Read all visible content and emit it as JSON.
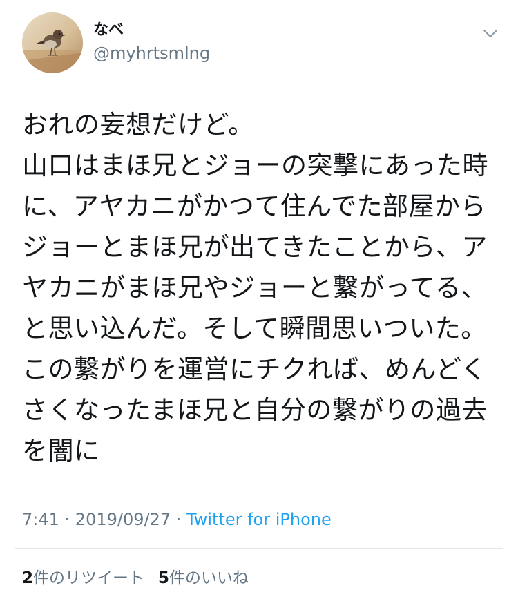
{
  "user": {
    "display_name": "なべ",
    "handle": "@myhrtsmlng",
    "avatar_icon": "sparrow-avatar"
  },
  "tweet": {
    "text": "おれの妄想だけど。\n山口はまほ兄とジョーの突撃にあった時に、アヤカニがかつて住んでた部屋からジョーとまほ兄が出てきたことから、アヤカニがまほ兄やジョーと繋がってる、と思い込んだ。そして瞬間思いついた。この繋がりを運営にチクれば、めんどくさくなったまほ兄と自分の繋がりの過去を闇に",
    "time": "7:41",
    "separator1": " · ",
    "date": "2019/09/27",
    "separator2": " · ",
    "source": "Twitter for iPhone"
  },
  "stats": {
    "retweets_count": "2",
    "retweets_label": "件のリツイート",
    "likes_count": "5",
    "likes_label": "件のいいね"
  },
  "colors": {
    "link": "#1da1f2",
    "secondary_text": "#657786",
    "primary_text": "#14171a",
    "divider": "#e1e8ed"
  },
  "icons": {
    "menu": "chevron-down-icon"
  }
}
